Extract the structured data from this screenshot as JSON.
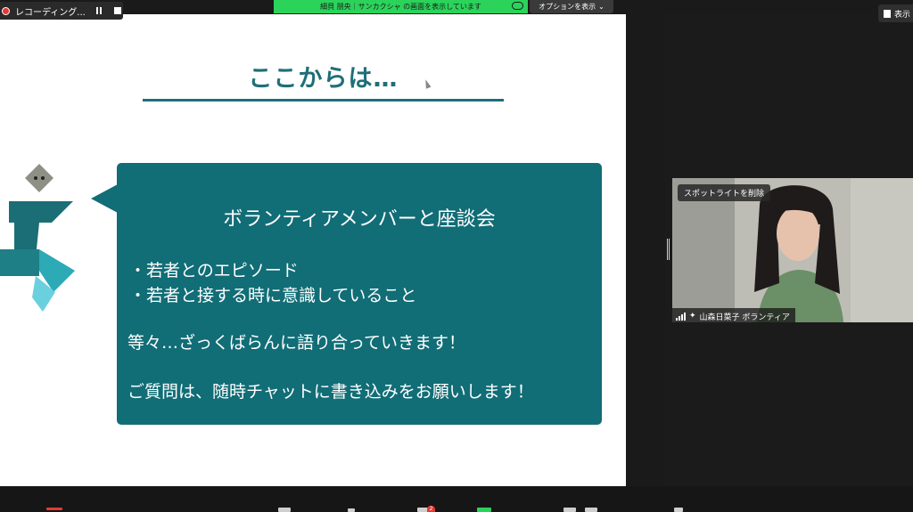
{
  "recording": {
    "label": "レコーディング..."
  },
  "share_banner": {
    "text": "細貝 朋央｜サンカクシャ の画面を表示しています"
  },
  "options": {
    "label": "オプションを表示"
  },
  "view": {
    "label": "表示"
  },
  "slide": {
    "title": "ここからは…",
    "bubble_heading": "ボランティアメンバーと座談会",
    "bullets": [
      "・若者とのエピソード",
      "・若者と接する時に意識していること"
    ],
    "line_3": "等々…ざっくばらんに語り合っていきます！",
    "line_4": "ご質問は、随時チャットに書き込みをお願いします！"
  },
  "video": {
    "spotlight_label": "スポットライトを削除",
    "participant_name": "山森日菜子 ボランティア"
  },
  "toolbar": {
    "chat_badge": "2"
  },
  "colors": {
    "teal": "#116d76",
    "title_teal": "#1e6f78",
    "share_green": "#2bd35b",
    "record_red": "#e53935"
  }
}
